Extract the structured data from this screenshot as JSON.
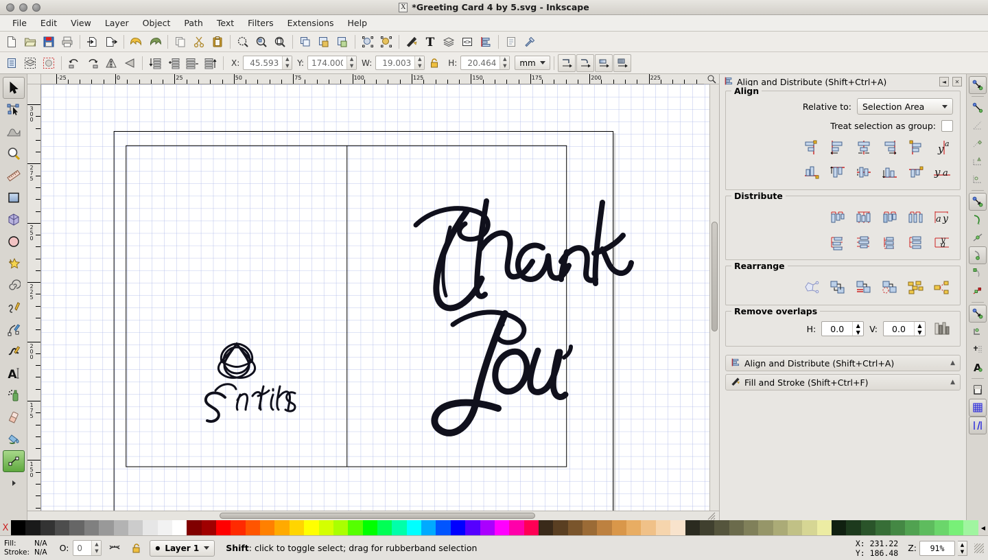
{
  "window": {
    "title": "*Greeting Card 4 by 5.svg - Inkscape",
    "app_icon": "X"
  },
  "menubar": {
    "items": [
      {
        "label": "File"
      },
      {
        "label": "Edit"
      },
      {
        "label": "View"
      },
      {
        "label": "Layer"
      },
      {
        "label": "Object"
      },
      {
        "label": "Path"
      },
      {
        "label": "Text"
      },
      {
        "label": "Filters"
      },
      {
        "label": "Extensions"
      },
      {
        "label": "Help"
      }
    ]
  },
  "command_toolbar": {
    "buttons": [
      {
        "name": "new-document-icon"
      },
      {
        "name": "open-document-icon"
      },
      {
        "name": "save-document-icon"
      },
      {
        "name": "print-document-icon"
      },
      {
        "name": "import-icon"
      },
      {
        "name": "export-icon"
      },
      {
        "name": "undo-icon"
      },
      {
        "name": "redo-icon"
      },
      {
        "name": "copy-icon"
      },
      {
        "name": "cut-icon"
      },
      {
        "name": "paste-icon"
      },
      {
        "name": "zoom-selection-icon"
      },
      {
        "name": "zoom-drawing-icon"
      },
      {
        "name": "zoom-page-icon"
      },
      {
        "name": "duplicate-icon"
      },
      {
        "name": "group-icon"
      },
      {
        "name": "ungroup-icon"
      },
      {
        "name": "object-properties-icon"
      },
      {
        "name": "xml-object-icon"
      },
      {
        "name": "fill-and-stroke-icon"
      },
      {
        "name": "text-and-font-icon"
      },
      {
        "name": "layers-icon"
      },
      {
        "name": "xml-editor-icon"
      },
      {
        "name": "align-and-distribute-icon"
      },
      {
        "name": "document-preferences-icon"
      },
      {
        "name": "inkscape-preferences-icon"
      }
    ]
  },
  "select_toolbar": {
    "buttons": [
      {
        "name": "select-all-icon"
      },
      {
        "name": "select-all-layers-icon"
      },
      {
        "name": "deselect-icon"
      },
      {
        "name": "rotate-ccw-icon"
      },
      {
        "name": "rotate-cw-icon"
      },
      {
        "name": "flip-horizontal-icon"
      },
      {
        "name": "flip-vertical-icon"
      },
      {
        "name": "lower-to-bottom-icon"
      },
      {
        "name": "lower-icon"
      },
      {
        "name": "raise-icon"
      },
      {
        "name": "raise-to-top-icon"
      }
    ],
    "x_label": "X:",
    "x_value": "45.593",
    "y_label": "Y:",
    "y_value": "174.000",
    "w_label": "W:",
    "w_value": "19.003",
    "lock_icon": "lock-ratio-icon",
    "h_label": "H:",
    "h_value": "20.464",
    "unit": "mm",
    "affect_buttons": [
      {
        "name": "affect-stroke-width-icon"
      },
      {
        "name": "affect-rounded-corners-icon"
      },
      {
        "name": "affect-gradients-icon"
      },
      {
        "name": "affect-patterns-icon"
      }
    ]
  },
  "toolbox": {
    "tools": [
      {
        "name": "selector-tool",
        "selected": true
      },
      {
        "name": "node-tool",
        "selected": false
      },
      {
        "name": "tweak-tool",
        "selected": false
      },
      {
        "name": "zoom-tool",
        "selected": false
      },
      {
        "name": "measure-tool",
        "selected": false
      },
      {
        "name": "rectangle-tool",
        "selected": false
      },
      {
        "name": "box3d-tool",
        "selected": false
      },
      {
        "name": "ellipse-tool",
        "selected": false
      },
      {
        "name": "star-tool",
        "selected": false
      },
      {
        "name": "spiral-tool",
        "selected": false
      },
      {
        "name": "pencil-tool",
        "selected": false
      },
      {
        "name": "bezier-tool",
        "selected": false
      },
      {
        "name": "calligraphy-tool",
        "selected": false
      },
      {
        "name": "text-tool",
        "selected": false
      },
      {
        "name": "spray-tool",
        "selected": false
      },
      {
        "name": "eraser-tool",
        "selected": false
      },
      {
        "name": "paint-bucket-tool",
        "selected": false
      },
      {
        "name": "gradient-tool",
        "selected": false
      },
      {
        "name": "more-tools-arrow",
        "selected": false
      }
    ]
  },
  "rulers": {
    "unit": "mm",
    "horizontal_labels": [
      "-25",
      "0",
      "25",
      "50",
      "75",
      "100",
      "125",
      "150",
      "175",
      "200",
      "225"
    ],
    "vertical_labels": [
      "300",
      "275",
      "250",
      "225",
      "200",
      "175",
      "150"
    ]
  },
  "canvas": {
    "document_text_line1": "Thank",
    "document_text_line2": "You",
    "signature_text": "Smiths",
    "logo": "triquetra-knot",
    "grid_color": "#9aa8e0",
    "page_border_color": "#000000"
  },
  "dock": {
    "header": {
      "title": "Align and Distribute (Shift+Ctrl+A)",
      "icon": "align-and-distribute-icon",
      "collapse_label": "◄",
      "close_label": "✕"
    },
    "align": {
      "group_label": "Align",
      "relative_to_label": "Relative to:",
      "relative_to_value": "Selection Area",
      "treat_as_group_label": "Treat selection as group:",
      "treat_as_group_checked": false,
      "row1": [
        {
          "name": "align-right-edge-to-left-anchor-icon"
        },
        {
          "name": "align-left-edges-icon"
        },
        {
          "name": "center-on-vertical-axis-icon"
        },
        {
          "name": "align-right-edges-icon"
        },
        {
          "name": "align-left-edge-to-right-anchor-icon"
        },
        {
          "name": "text-align-baseline-vertical-icon"
        }
      ],
      "row2": [
        {
          "name": "align-bottom-edge-to-top-anchor-icon"
        },
        {
          "name": "align-top-edges-icon"
        },
        {
          "name": "center-on-horizontal-axis-icon"
        },
        {
          "name": "align-bottom-edges-icon"
        },
        {
          "name": "align-top-edge-to-bottom-anchor-icon"
        },
        {
          "name": "text-align-baseline-horizontal-icon"
        }
      ]
    },
    "distribute": {
      "group_label": "Distribute",
      "row1": [
        {
          "name": "distribute-left-edges-icon"
        },
        {
          "name": "distribute-centers-horizontal-icon"
        },
        {
          "name": "distribute-right-edges-icon"
        },
        {
          "name": "distribute-horizontal-gaps-icon"
        },
        {
          "name": "distribute-text-baselines-horizontal-icon"
        }
      ],
      "row2": [
        {
          "name": "distribute-top-edges-icon"
        },
        {
          "name": "distribute-centers-vertical-icon"
        },
        {
          "name": "distribute-bottom-edges-icon"
        },
        {
          "name": "distribute-vertical-gaps-icon"
        },
        {
          "name": "distribute-text-baselines-vertical-icon"
        }
      ]
    },
    "rearrange": {
      "group_label": "Rearrange",
      "buttons": [
        {
          "name": "exchange-positions-graph-icon"
        },
        {
          "name": "exchange-positions-selection-order-icon"
        },
        {
          "name": "exchange-positions-zorder-icon"
        },
        {
          "name": "exchange-positions-clockwise-icon"
        },
        {
          "name": "randomize-positions-icon"
        },
        {
          "name": "unclump-objects-icon"
        }
      ]
    },
    "remove_overlaps": {
      "group_label": "Remove overlaps",
      "h_label": "H:",
      "h_value": "0.0",
      "v_label": "V:",
      "v_value": "0.0",
      "apply_icon": "remove-overlaps-icon"
    },
    "collapsed_panels": [
      {
        "label": "Align and Distribute (Shift+Ctrl+A)",
        "icon": "align-and-distribute-icon",
        "arrow": "▲"
      },
      {
        "label": "Fill and Stroke (Shift+Ctrl+F)",
        "icon": "fill-and-stroke-icon",
        "arrow": "▲"
      }
    ]
  },
  "snapbar": {
    "buttons": [
      {
        "name": "enable-snapping-icon",
        "on": true
      },
      {
        "name": "snap-bounding-boxes-icon",
        "on": false
      },
      {
        "name": "snap-bbox-edges-icon",
        "on": false
      },
      {
        "name": "snap-bbox-corners-icon",
        "on": false
      },
      {
        "name": "snap-bbox-edge-midpoints-icon",
        "on": false
      },
      {
        "name": "snap-bbox-centers-icon",
        "on": false
      },
      {
        "name": "snap-nodes-paths-icon",
        "on": true
      },
      {
        "name": "snap-to-paths-icon",
        "on": false
      },
      {
        "name": "snap-path-intersections-icon",
        "on": false
      },
      {
        "name": "snap-to-nodes-icon",
        "on": true
      },
      {
        "name": "snap-smooth-nodes-icon",
        "on": false
      },
      {
        "name": "snap-midpoints-line-segments-icon",
        "on": false
      },
      {
        "name": "snap-others-icon",
        "on": true
      },
      {
        "name": "snap-object-centers-icon",
        "on": false
      },
      {
        "name": "snap-rotation-centers-icon",
        "on": false
      },
      {
        "name": "snap-text-baselines-icon",
        "on": false
      },
      {
        "name": "snap-page-border-icon",
        "on": false
      },
      {
        "name": "snap-grids-icon",
        "on": true
      },
      {
        "name": "snap-guides-icon",
        "on": true
      }
    ]
  },
  "palette": {
    "swatches": [
      "#000000",
      "#1a1a1a",
      "#333333",
      "#4d4d4d",
      "#666666",
      "#808080",
      "#999999",
      "#b3b3b3",
      "#cccccc",
      "#e6e6e6",
      "#f2f2f2",
      "#ffffff",
      "#800000",
      "#a00000",
      "#ff0000",
      "#ff2a00",
      "#ff5500",
      "#ff8000",
      "#ffaa00",
      "#ffd500",
      "#ffff00",
      "#d4ff00",
      "#aaff00",
      "#55ff00",
      "#00ff00",
      "#00ff55",
      "#00ffaa",
      "#00ffff",
      "#00aaff",
      "#0055ff",
      "#0000ff",
      "#5500ff",
      "#aa00ff",
      "#ff00ff",
      "#ff00aa",
      "#ff0055",
      "#3a2a1a",
      "#5a3f22",
      "#7a552c",
      "#9b6b36",
      "#bd8140",
      "#d9974a",
      "#e8ad63",
      "#f0c188",
      "#f6d5ad",
      "#f8e3cc",
      "#2b2b20",
      "#40402f",
      "#55553d",
      "#6b6b4c",
      "#80805a",
      "#969669",
      "#abab77",
      "#c1c186",
      "#d6d694",
      "#ececa3",
      "#102010",
      "#1d3a1d",
      "#2a542a",
      "#376e37",
      "#448844",
      "#51a251",
      "#5ebc5e",
      "#6bd66b",
      "#78f078",
      "#a0f5a0"
    ],
    "x_label": "X"
  },
  "statusbar": {
    "fill_label": "Fill:",
    "fill_value": "N/A",
    "stroke_label": "Stroke:",
    "stroke_value": "N/A",
    "opacity_label": "O:",
    "opacity_value": "0",
    "hide_layer_icon": "eye-closed-icon",
    "lock_layer_icon": "unlock-icon",
    "layer_name": "Layer 1",
    "hint_bold": "Shift",
    "hint_rest": ": click to toggle select; drag for rubberband selection",
    "x_label": "X:",
    "x_value": "231.22",
    "y_label": "Y:",
    "y_value": "186.48",
    "zoom_label": "Z:",
    "zoom_value": "91%"
  }
}
